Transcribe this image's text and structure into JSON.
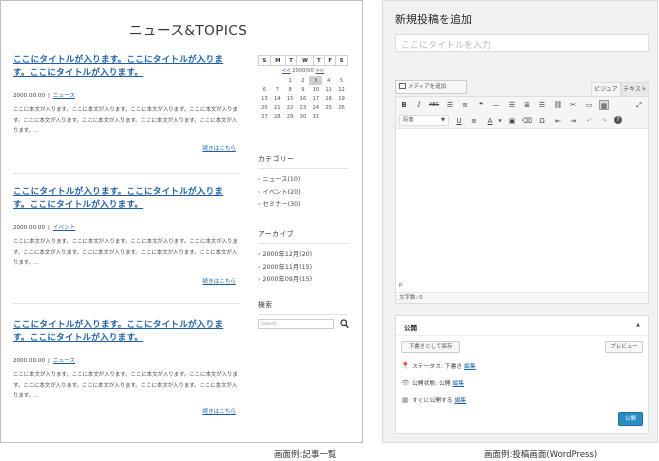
{
  "left": {
    "site_title": "ニュース&TOPICS",
    "posts": [
      {
        "title": "ここにタイトルが入ります。ここにタイトルが入ります。ここにタイトルが入ります。",
        "date": "2000.00.00",
        "category": "ニュース",
        "body": "ここに本文が入ります。ここに本文が入ります。ここに本文が入ります。ここに本文が入ります。ここに本文が入ります。ここに本文が入ります。ここに本文が入ります。ここに本文が入ります。…",
        "more": "続きはこちら"
      },
      {
        "title": "ここにタイトルが入ります。ここにタイトルが入ります。ここにタイトルが入ります。",
        "date": "2000.00.00",
        "category": "イベント",
        "body": "ここに本文が入ります。ここに本文が入ります。ここに本文が入ります。ここに本文が入ります。ここに本文が入ります。ここに本文が入ります。ここに本文が入ります。ここに本文が入ります。…",
        "more": "続きはこちら"
      },
      {
        "title": "ここにタイトルが入ります。ここにタイトルが入ります。ここにタイトルが入ります。",
        "date": "2000.00.00",
        "category": "ニュース",
        "body": "ここに本文が入ります。ここに本文が入ります。ここに本文が入ります。ここに本文が入ります。ここに本文が入ります。ここに本文が入ります。ここに本文が入ります。ここに本文が入ります。…",
        "more": "続きはこちら"
      }
    ],
    "calendar": {
      "days": [
        "S",
        "M",
        "T",
        "W",
        "T",
        "F",
        "S"
      ],
      "prev": "<<",
      "month": "2000/00",
      "next": ">>",
      "rows": [
        [
          "",
          "",
          "1",
          "2",
          "3",
          "4",
          "5"
        ],
        [
          "6",
          "7",
          "8",
          "9",
          "10",
          "11",
          "12"
        ],
        [
          "13",
          "14",
          "15",
          "16",
          "17",
          "18",
          "19"
        ],
        [
          "20",
          "21",
          "22",
          "23",
          "24",
          "25",
          "26"
        ],
        [
          "27",
          "28",
          "29",
          "30",
          "31",
          "",
          ""
        ]
      ],
      "today": "3"
    },
    "categories": {
      "heading": "カテゴリー",
      "items": [
        "ニュース(10)",
        "イベント(20)",
        "セミナー(30)"
      ]
    },
    "archive": {
      "heading": "アーカイブ",
      "items": [
        "2000年12月(20)",
        "2000年11月(15)",
        "2000年09月(15)"
      ]
    },
    "search": {
      "heading": "検索",
      "placeholder": "Search"
    }
  },
  "right": {
    "heading": "新規投稿を追加",
    "title_placeholder": "ここにタイトルを入力",
    "media_button": "メディアを追加",
    "tab_visual": "ビジュアル",
    "tab_text": "テキスト",
    "format_select": "段落",
    "editor_path": "p",
    "word_count": "文字数: 0",
    "publish": {
      "heading": "公開",
      "save_draft": "下書きとして保存",
      "preview": "プレビュー",
      "status_label": "ステータス: 下書き",
      "visibility_label": "公開状態: 公開",
      "schedule_label": "すぐに公開する",
      "edit": "編集",
      "publish_button": "公開"
    }
  },
  "captions": {
    "left": "画面例:記事一覧",
    "right": "画面例:投稿画面(WordPress)"
  }
}
